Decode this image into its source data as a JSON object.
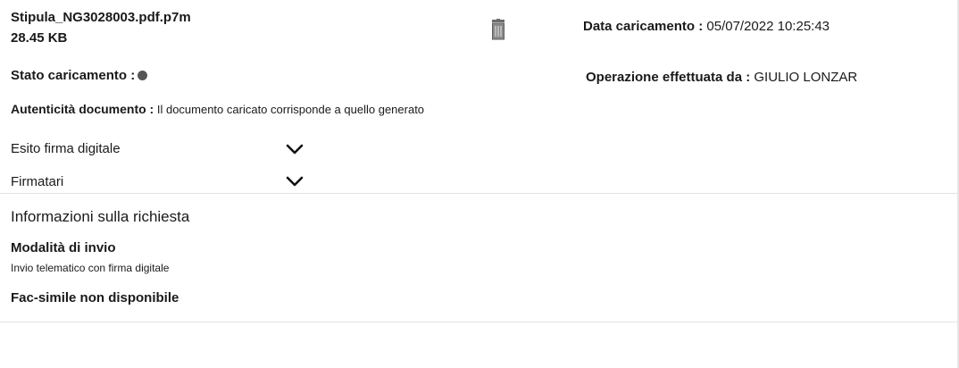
{
  "file": {
    "name": "Stipula_NG3028003.pdf.p7m",
    "size": "28.45 KB",
    "delete_icon": "trash-icon"
  },
  "upload_date": {
    "label": "Data caricamento :",
    "value": " 05/07/2022 10:25:43"
  },
  "upload_status": {
    "label": "Stato caricamento :",
    "dot_color": "#555555"
  },
  "operator": {
    "label": "Operazione effettuata da :",
    "value": " GIULIO LONZAR"
  },
  "authenticity": {
    "label": "Autenticità documento :",
    "value": " Il documento caricato corrisponde a quello generato"
  },
  "accordions": {
    "esito": {
      "label": "Esito firma digitale",
      "icon": "chevron-down-icon"
    },
    "firmatari": {
      "label": "Firmatari",
      "icon": "chevron-down-icon"
    }
  },
  "request_info": {
    "title": "Informazioni sulla richiesta",
    "mode_label": "Modalità di invio",
    "mode_value": "Invio telematico con firma digitale",
    "facsimile": "Fac-simile non disponibile"
  }
}
